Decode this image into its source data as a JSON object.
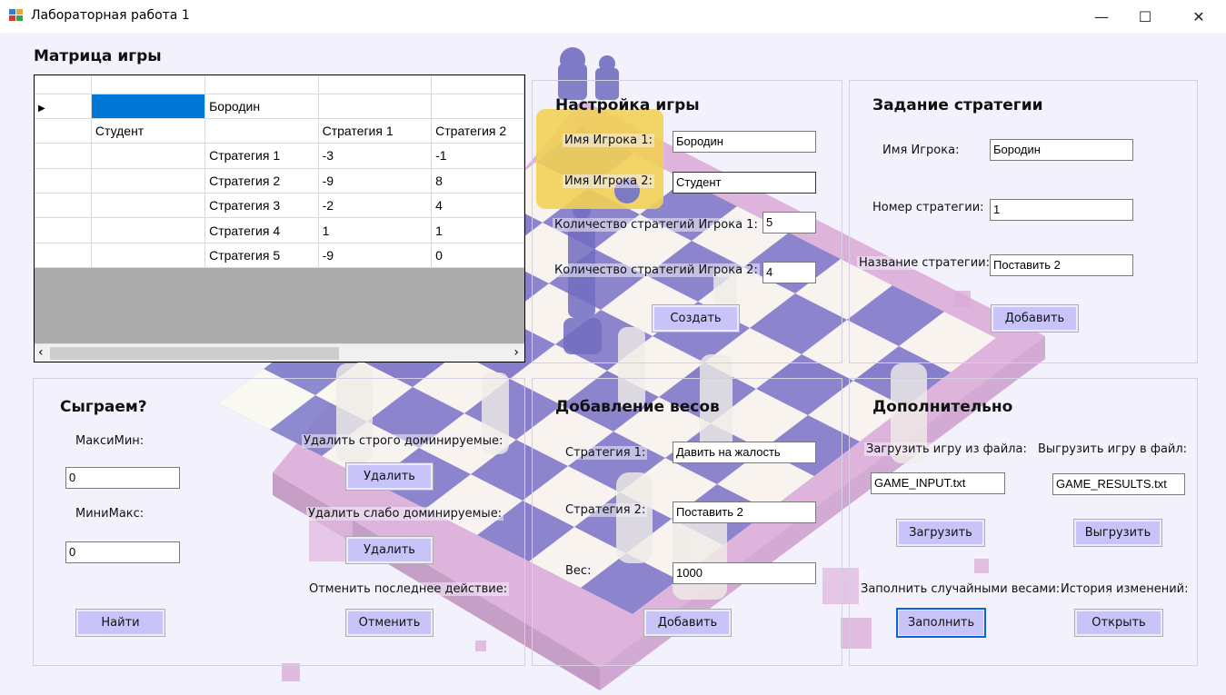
{
  "window": {
    "title": "Лабораторная работа 1",
    "minimize": "—",
    "maximize": "☐",
    "close": "✕"
  },
  "matrix": {
    "title": "Матрица игры",
    "header": [
      "",
      "",
      "",
      ""
    ],
    "player1_row": [
      "",
      "Бородин",
      "",
      ""
    ],
    "player2_row": [
      "Студент",
      "",
      "Стратегия 1",
      "Стратегия 2"
    ],
    "rows": [
      [
        "",
        "Стратегия 1",
        "-3",
        "-1"
      ],
      [
        "",
        "Стратегия 2",
        "-9",
        "8"
      ],
      [
        "",
        "Стратегия 3",
        "-2",
        "4"
      ],
      [
        "",
        "Стратегия 4",
        "1",
        "1"
      ],
      [
        "",
        "Стратегия 5",
        "-9",
        "0"
      ]
    ],
    "row_indicator": "▶",
    "scroll_left": "‹",
    "scroll_right": "›"
  },
  "setup": {
    "title": "Настройка игры",
    "player1_label": "Имя Игрока 1:",
    "player1_value": "Бородин",
    "player2_label": "Имя Игрока 2:",
    "player2_value": "Студент",
    "count1_label": "Количество стратегий Игрока 1:",
    "count1_value": "5",
    "count2_label": "Количество стратегий Игрока 2:",
    "count2_value": "4",
    "create_button": "Создать"
  },
  "strategy": {
    "title": "Задание стратегии",
    "player_label": "Имя Игрока:",
    "player_value": "Бородин",
    "number_label": "Номер стратегии:",
    "number_value": "1",
    "name_label": "Название стратегии:",
    "name_value": "Поставить 2",
    "add_button": "Добавить"
  },
  "play": {
    "title": "Сыграем?",
    "maximin_label": "МаксиМин:",
    "maximin_value": "0",
    "minimax_label": "МиниМакс:",
    "minimax_value": "0",
    "find_button": "Найти",
    "strict_label": "Удалить строго доминируемые:",
    "strict_button": "Удалить",
    "weak_label": "Удалить слабо доминируемые:",
    "weak_button": "Удалить",
    "undo_label": "Отменить последнее действие:",
    "undo_button": "Отменить"
  },
  "weights": {
    "title": "Добавление весов",
    "s1_label": "Стратегия 1:",
    "s1_value": "Давить на жалость",
    "s2_label": "Стратегия 2:",
    "s2_value": "Поставить 2",
    "weight_label": "Вес:",
    "weight_value": "1000",
    "add_button": "Добавить"
  },
  "extra": {
    "title": "Дополнительно",
    "load_label": "Загрузить игру из файла:",
    "load_value": "GAME_INPUT.txt",
    "load_button": "Загрузить",
    "save_label": "Выгрузить игру в файл:",
    "save_value": "GAME_RESULTS.txt",
    "save_button": "Выгрузить",
    "random_label": "Заполнить случайными весами:",
    "random_button": "Заполнить",
    "history_label": "История изменений:",
    "history_button": "Открыть"
  },
  "colors": {
    "accent": "#0078d7",
    "button": "#c8c4fa",
    "board_dark": "#7b77c9",
    "board_frame": "#d9a7d8"
  }
}
